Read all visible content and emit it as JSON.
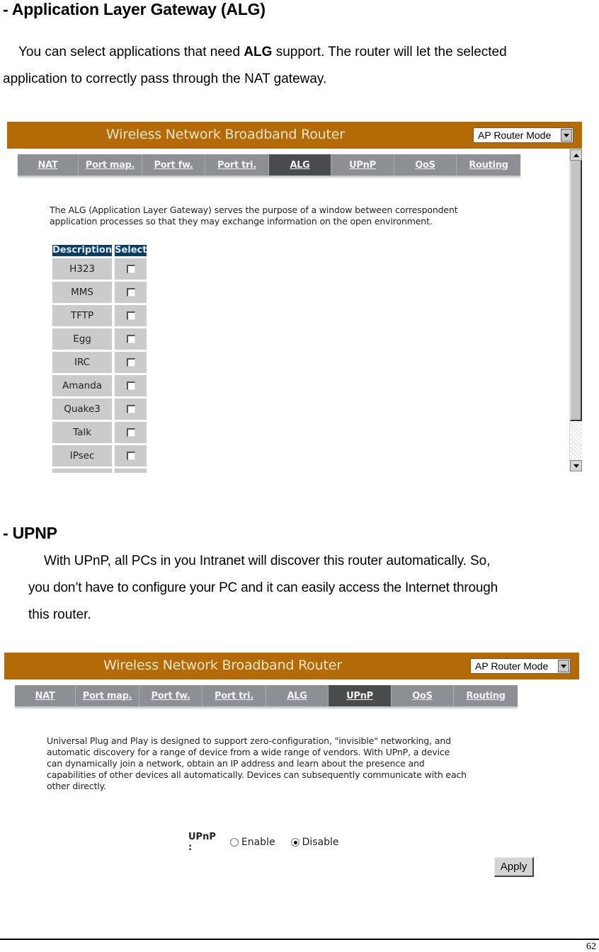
{
  "alg_section": {
    "heading": "- Application Layer Gateway (ALG)",
    "para_pre": "You can select applications that need ",
    "para_bold": "ALG",
    "para_post": " support. The router will let the selected",
    "para_line2": "application to correctly pass through the NAT gateway."
  },
  "alg_screen": {
    "title": "Wireless Network Broadband Router",
    "mode_select": "AP Router Mode",
    "tabs": [
      "NAT",
      "Port map.",
      "Port fw.",
      "Port tri.",
      "ALG",
      "UPnP",
      "QoS",
      "Routing"
    ],
    "active_tab": "ALG",
    "description_line1": "The ALG (Application Layer Gateway) serves the purpose of a window between correspondent",
    "description_line2": "application processes so that they may exchange information on the open environment.",
    "table": {
      "headers": [
        "Description",
        "Select"
      ],
      "rows": [
        {
          "name": "H323",
          "checked": false
        },
        {
          "name": "MMS",
          "checked": false
        },
        {
          "name": "TFTP",
          "checked": false
        },
        {
          "name": "Egg",
          "checked": false
        },
        {
          "name": "IRC",
          "checked": false
        },
        {
          "name": "Amanda",
          "checked": false
        },
        {
          "name": "Quake3",
          "checked": false
        },
        {
          "name": "Talk",
          "checked": false
        },
        {
          "name": "IPsec",
          "checked": false
        }
      ]
    }
  },
  "upnp_section": {
    "heading": "- UPNP",
    "para_line1": "With UPnP, all PCs in you Intranet will discover this router automatically. So,",
    "para_line2": "you don’t have to configure your PC and it can easily access the Internet through",
    "para_line3": "this router."
  },
  "upnp_screen": {
    "title": "Wireless Network Broadband Router",
    "mode_select": "AP Router Mode",
    "tabs": [
      "NAT",
      "Port map.",
      "Port fw.",
      "Port tri.",
      "ALG",
      "UPnP",
      "QoS",
      "Routing"
    ],
    "active_tab": "UPnP",
    "description_lines": [
      "Universal Plug and Play is designed to support zero-configuration, \"invisible\" networking, and",
      "automatic discovery for a range of device from a wide range of vendors. With UPnP, a device",
      "can dynamically join a network, obtain an IP address and learn about the presence and",
      "capabilities of other devices all automatically. Devices can subsequently communicate with each",
      "other directly."
    ],
    "upnp_label": "UPnP :",
    "options": [
      "Enable",
      "Disable"
    ],
    "selected_option": "Disable",
    "apply_label": "Apply"
  },
  "footer": {
    "page_number": "62"
  }
}
